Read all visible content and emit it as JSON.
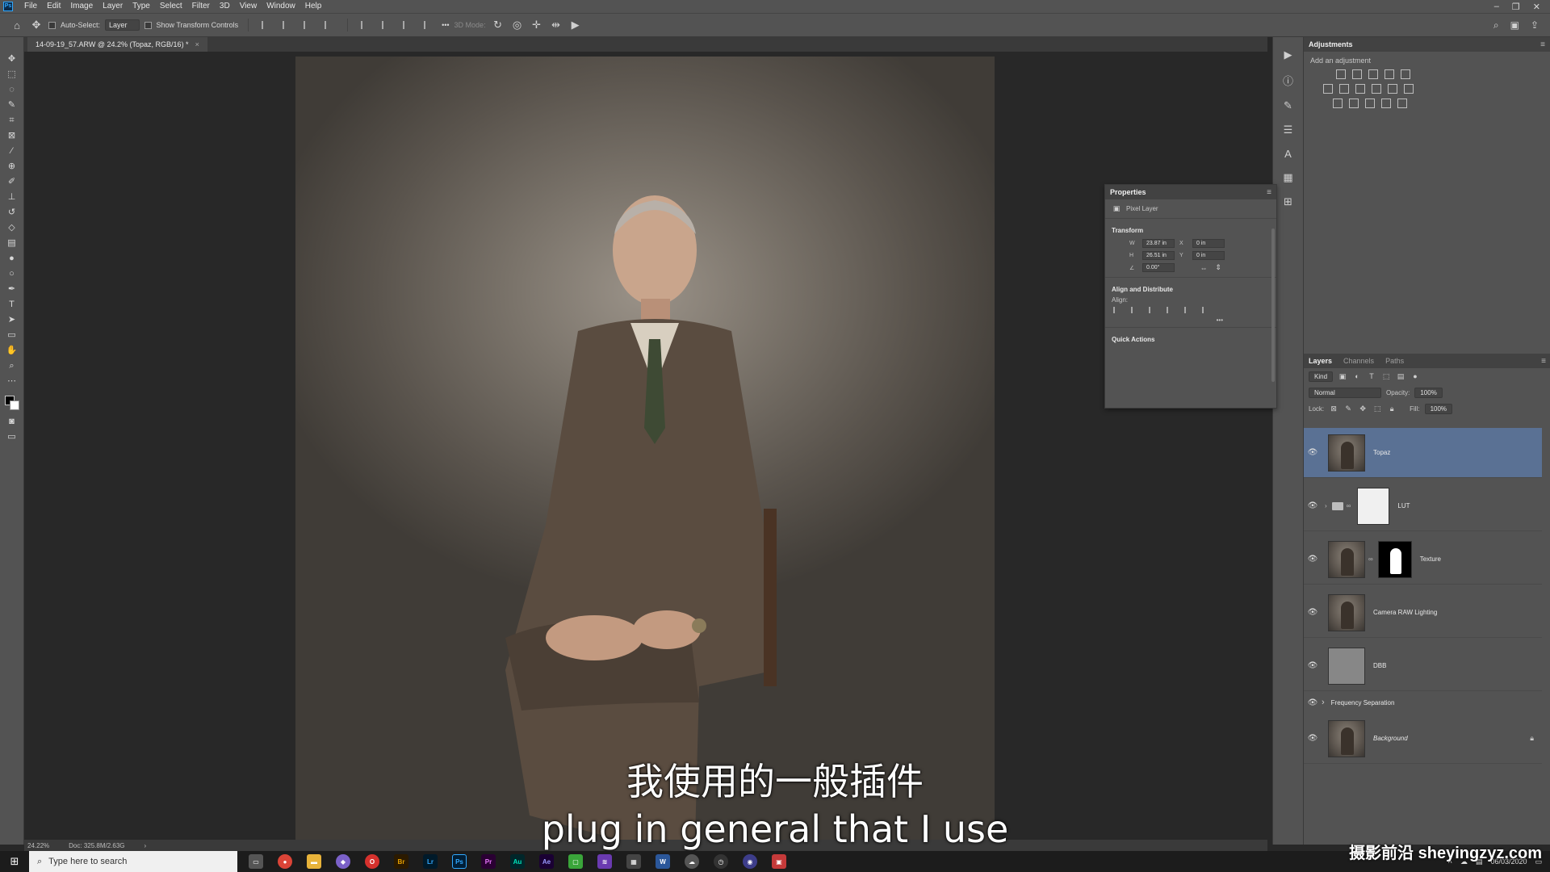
{
  "menubar": {
    "app_logo": "Ps",
    "items": [
      "File",
      "Edit",
      "Image",
      "Layer",
      "Type",
      "Select",
      "Filter",
      "3D",
      "View",
      "Window",
      "Help"
    ],
    "window_controls": [
      "–",
      "❐",
      "✕"
    ]
  },
  "options_bar": {
    "auto_select_label": "Auto-Select:",
    "auto_select_value": "Layer",
    "show_transform_label": "Show Transform Controls",
    "more_label": "•••",
    "mode_3d_label": "3D Mode:"
  },
  "document": {
    "tab_title": "14-09-19_57.ARW @ 24.2% (Topaz, RGB/16) *",
    "tab_close": "×"
  },
  "status_bar": {
    "zoom": "24.22%",
    "doc_size": "Doc: 325.8M/2.63G",
    "arrow": "›"
  },
  "subtitles": {
    "zh": "我使用的一般插件",
    "en": "plug in general that I use"
  },
  "adjustments": {
    "title": "Adjustments",
    "hint": "Add an adjustment"
  },
  "properties": {
    "title": "Properties",
    "layer_type": "Pixel Layer",
    "transform_title": "Transform",
    "w_label": "W",
    "w_value": "23.87 in",
    "h_label": "H",
    "h_value": "26.51 in",
    "x_label": "X",
    "x_value": "0 in",
    "y_label": "Y",
    "y_value": "0 in",
    "angle_value": "0.00°",
    "align_title": "Align and Distribute",
    "align_label": "Align:",
    "more": "•••",
    "quick_actions_title": "Quick Actions"
  },
  "layers_panel": {
    "tabs": [
      "Layers",
      "Channels",
      "Paths"
    ],
    "kind_label": "Kind",
    "blend_mode": "Normal",
    "opacity_label": "Opacity:",
    "opacity_value": "100%",
    "lock_label": "Lock:",
    "fill_label": "Fill:",
    "fill_value": "100%",
    "layers": [
      {
        "name": "Topaz"
      },
      {
        "name": "LUT"
      },
      {
        "name": "Texture"
      },
      {
        "name": "Camera RAW Lighting"
      },
      {
        "name": "DBB"
      },
      {
        "name": "Frequency Separation"
      },
      {
        "name": "Background"
      }
    ]
  },
  "taskbar": {
    "search_placeholder": "Type here to search",
    "apps": [
      "Br",
      "Lr",
      "Ps",
      "Pr",
      "Au",
      "Ae",
      "W"
    ],
    "date": "06/03/2020"
  },
  "watermark": "摄影前沿 sheyingzyz.com",
  "colors": {
    "accent_selected": "#5a7194",
    "ps_blue": "#31a8ff",
    "panel_bg": "#535353"
  }
}
